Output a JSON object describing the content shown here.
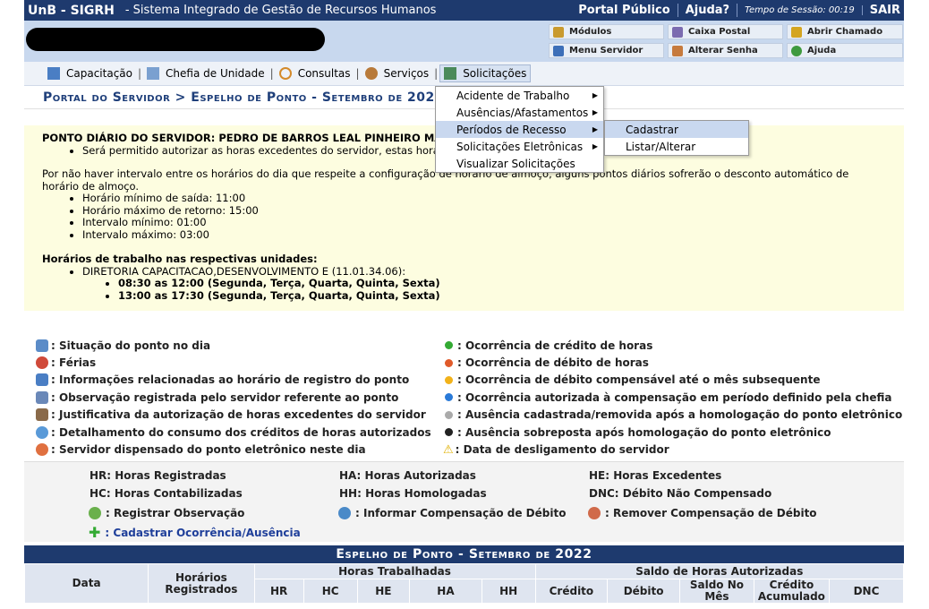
{
  "topbar": {
    "brand": "UnB - SIGRH",
    "system_name": "- Sistema Integrado de Gestão de Recursos Humanos",
    "portal_link": "Portal Público",
    "help_link": "Ajuda?",
    "session": "Tempo de Sessão: 00:19",
    "logout": "SAIR"
  },
  "quick_links": [
    {
      "label": "Módulos",
      "icon": "modules-icon",
      "color": "#c99a2e"
    },
    {
      "label": "Caixa Postal",
      "icon": "mailbox-icon",
      "color": "#7b6bb0"
    },
    {
      "label": "Abrir Chamado",
      "icon": "bell-icon",
      "color": "#d4a520"
    },
    {
      "label": "Menu Servidor",
      "icon": "menu-server-icon",
      "color": "#3d6fb8"
    },
    {
      "label": "Alterar Senha",
      "icon": "key-icon",
      "color": "#c67a3d"
    },
    {
      "label": "Ajuda",
      "icon": "help-icon",
      "color": "#3e9a3e"
    }
  ],
  "menu": [
    {
      "label": "Capacitação",
      "icon": "training-icon"
    },
    {
      "label": "Chefia de Unidade",
      "icon": "unit-chief-icon"
    },
    {
      "label": "Consultas",
      "icon": "search-icon"
    },
    {
      "label": "Serviços",
      "icon": "services-icon"
    },
    {
      "label": "Solicitações",
      "icon": "requests-icon"
    }
  ],
  "breadcrumb": "Portal do Servidor > Espelho de Ponto - Setembro de 2022",
  "dropdown": {
    "items": [
      "Acidente de Trabalho",
      "Ausências/Afastamentos",
      "Períodos de Recesso",
      "Solicitações Eletrônicas",
      "Visualizar Solicitações"
    ],
    "submenu": [
      "Cadastrar",
      "Listar/Alterar"
    ]
  },
  "info": {
    "title": "PONTO DIÁRIO DO SERVIDOR: PEDRO DE BARROS LEAL PINHEIRO MA",
    "bullet1": "Será permitido autorizar as horas excedentes do servidor, estas horas",
    "paragraph": "Por não haver intervalo entre os horários do dia que respeite a configuração de horário de almoço, alguns pontos diários sofrerão o desconto automático de horário de almoço.",
    "rules": [
      "Horário mínimo de saída: 11:00",
      "Horário máximo de retorno: 15:00",
      "Intervalo mínimo: 01:00",
      "Intervalo máximo: 03:00"
    ],
    "units_title": "Horários de trabalho nas respectivas unidades:",
    "unit": "DIRETORIA CAPACITACAO,DESENVOLVIMENTO E (11.01.34.06):",
    "schedules": [
      "08:30 as 12:00 (Segunda, Terça, Quarta, Quinta, Sexta)",
      "13:00 as 17:30 (Segunda, Terça, Quarta, Quinta, Sexta)"
    ]
  },
  "legend_left": [
    {
      "label": ": Situação do ponto no dia",
      "icon": "clock-status-icon",
      "color": "#5b8cc8"
    },
    {
      "label": ": Férias",
      "icon": "lifebuoy-icon",
      "color": "#d04a3a"
    },
    {
      "label": ": Informações relacionadas ao horário de registro do ponto",
      "icon": "info-icon",
      "color": "#4a7ec4"
    },
    {
      "label": ": Observação registrada pelo servidor referente ao ponto",
      "icon": "user-note-icon",
      "color": "#6a88b8"
    },
    {
      "label": ": Justificativa da autorização de horas excedentes do servidor",
      "icon": "user-icon",
      "color": "#8a6a4a"
    },
    {
      "label": ": Detalhamento do consumo dos créditos de horas autorizados",
      "icon": "clock-icon",
      "color": "#5a9ad8"
    },
    {
      "label": ": Servidor dispensado do ponto eletrônico neste dia",
      "icon": "dismissed-icon",
      "color": "#e07040"
    }
  ],
  "legend_right": [
    {
      "label": ": Ocorrência de crédito de horas",
      "color": "#33aa33"
    },
    {
      "label": ": Ocorrência de débito de horas",
      "color": "#e05a2a"
    },
    {
      "label": ": Ocorrência de débito compensável até o mês subsequente",
      "color": "#f2b21a"
    },
    {
      "label": ": Ocorrência autorizada à compensação em período definido pela chefia",
      "color": "#2a7ad8"
    },
    {
      "label": ": Ausência cadastrada/removida após a homologação do ponto eletrônico",
      "color": "#aaaaaa"
    },
    {
      "label": ": Ausência sobreposta após homologação do ponto eletrônico",
      "color": "#222222"
    },
    {
      "label": ": Data de desligamento do servidor",
      "color": "#f2c21a"
    }
  ],
  "abbreviations": [
    "HR: Horas Registradas",
    "HA: Horas Autorizadas",
    "HE: Horas Excedentes",
    "HC: Horas Contabilizadas",
    "HH: Horas Homologadas",
    "DNC: Débito Não Compensado"
  ],
  "actions": {
    "register_obs": ": Registrar Observação",
    "inform_comp": ": Informar Compensação de Débito",
    "remove_comp": ": Remover Compensação de Débito",
    "register_occ": ": Cadastrar Ocorrência/Ausência"
  },
  "table": {
    "title": "Espelho de Ponto - Setembro de 2022",
    "col_data": "Data",
    "col_registered": "Horários Registrados",
    "group_worked": "Horas Trabalhadas",
    "group_balance": "Saldo de Horas Autorizadas",
    "worked_cols": [
      "HR",
      "HC",
      "HE",
      "HA",
      "HH"
    ],
    "balance_cols": [
      "Crédito",
      "Débito",
      "Saldo No Mês",
      "Crédito Acumulado",
      "DNC"
    ]
  }
}
